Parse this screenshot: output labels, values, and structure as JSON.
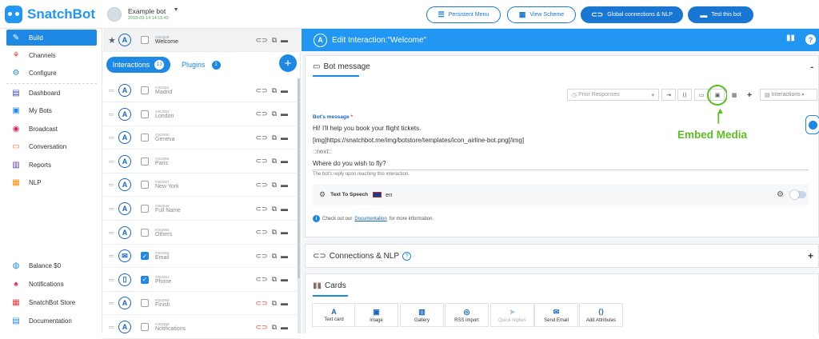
{
  "header": {
    "brand": "SnatchBot",
    "bot_name": "Example bot",
    "bot_date": "2018-09-14 14:11:40",
    "persistent_menu": "Persistent Menu",
    "view_scheme": "View Scheme",
    "global_connections": "Global connections & NLP",
    "test_bot": "Test this bot"
  },
  "sidebar": {
    "items": [
      {
        "label": "Build",
        "icon": "wrench-icon",
        "active": true
      },
      {
        "label": "Channels",
        "icon": "channels-icon"
      },
      {
        "label": "Configure",
        "icon": "gear-icon"
      },
      {
        "label": "Dashboard",
        "icon": "dashboard-icon"
      },
      {
        "label": "My Bots",
        "icon": "bots-icon"
      },
      {
        "label": "Broadcast",
        "icon": "broadcast-icon"
      },
      {
        "label": "Conversation",
        "icon": "conversation-icon"
      },
      {
        "label": "Reports",
        "icon": "reports-icon"
      },
      {
        "label": "NLP",
        "icon": "nlp-icon"
      }
    ],
    "bottom": [
      {
        "label": "Balance $0",
        "icon": "balance-icon"
      },
      {
        "label": "Notifications",
        "icon": "bell-icon"
      },
      {
        "label": "SnatchBot Store",
        "icon": "store-icon"
      },
      {
        "label": "Documentation",
        "icon": "doc-icon"
      }
    ]
  },
  "list": {
    "pinned": {
      "id": "#362948",
      "name": "Welcome"
    },
    "tab_interactions": "Interactions",
    "interactions_count": "13",
    "tab_plugins": "Plugins",
    "plugins_count": "1",
    "rows": [
      {
        "id": "#362952",
        "name": "Madrid",
        "checked": false
      },
      {
        "id": "#362953",
        "name": "London",
        "checked": false
      },
      {
        "id": "#362955",
        "name": "Geneva",
        "checked": false
      },
      {
        "id": "#362956",
        "name": "Paris",
        "checked": false
      },
      {
        "id": "#362957",
        "name": "New York",
        "checked": false
      },
      {
        "id": "#362949",
        "name": "Full Name",
        "checked": false
      },
      {
        "id": "#362958",
        "name": "Others",
        "checked": false
      },
      {
        "id": "#362950",
        "name": "Email",
        "checked": true
      },
      {
        "id": "#362951",
        "name": "Phone",
        "checked": true
      },
      {
        "id": "#362959",
        "name": "Finish",
        "checked": false
      },
      {
        "id": "#362959",
        "name": "Notifications",
        "checked": false
      }
    ]
  },
  "main": {
    "title": "Edit Interaction:\"Welcome\"",
    "bot_message": {
      "title": "Bot message",
      "collapse": "-",
      "prior": "Prior Responses",
      "interactions": "Interactions",
      "label": "Bot's message",
      "req": "*",
      "lines": [
        "Hi! I'll help you book your flight tickets.",
        "[img]https://snatchbot.me/img/botstore/templates/icon_airline-bot.png[/img]",
        "::next::",
        "Where do you wish to fly?"
      ],
      "hint": "The bot's reply upon reaching this interaction.",
      "tts_label": "Text To Speech",
      "tts_lang": "en",
      "doc_pre": "Check out our",
      "doc_link": "Documentation",
      "doc_post": "for more information.",
      "annotation": "Embed Media"
    },
    "connections": {
      "title": "Connections & NLP",
      "toggle": "+"
    },
    "cards": {
      "title": "Cards",
      "buttons": [
        {
          "label": "Text card",
          "icon": "text-card-icon",
          "glyph": "A"
        },
        {
          "label": "Image",
          "icon": "image-icon",
          "glyph": "▣"
        },
        {
          "label": "Gallery",
          "icon": "gallery-icon",
          "glyph": "▥"
        },
        {
          "label": "RSS import",
          "icon": "rss-icon",
          "glyph": "◎"
        },
        {
          "label": "Quick replies",
          "icon": "send-icon",
          "glyph": "➤"
        },
        {
          "label": "Send Email",
          "icon": "mail-icon",
          "glyph": "✉"
        },
        {
          "label": "Add Attributes",
          "icon": "attributes-icon",
          "glyph": "⟨⟩"
        }
      ]
    }
  },
  "colors": {
    "accent": "#1e88e5",
    "bar": "#2196f3",
    "annotation": "#5bbf1f"
  }
}
